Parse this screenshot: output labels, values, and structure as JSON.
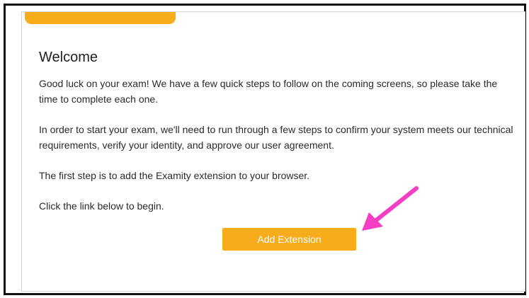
{
  "colors": {
    "accent": "#f7ad1b",
    "progress": "#f7ad1b",
    "annotation_arrow": "#f23fc4"
  },
  "progress": {
    "fraction": 0.3
  },
  "welcome": {
    "title": "Welcome",
    "paragraph1": "Good luck on your exam! We have a few quick steps to follow on the coming screens, so please take the time to complete each one.",
    "paragraph2": "In order to start your exam, we'll need to run through a few steps to confirm your system meets our technical requirements, verify your identity, and approve our user agreement.",
    "paragraph3": "The first step is to add the Examity extension to your browser.",
    "paragraph4": "Click the link below to begin."
  },
  "actions": {
    "add_extension_label": "Add Extension"
  },
  "annotation": {
    "icon": "arrow-icon"
  }
}
